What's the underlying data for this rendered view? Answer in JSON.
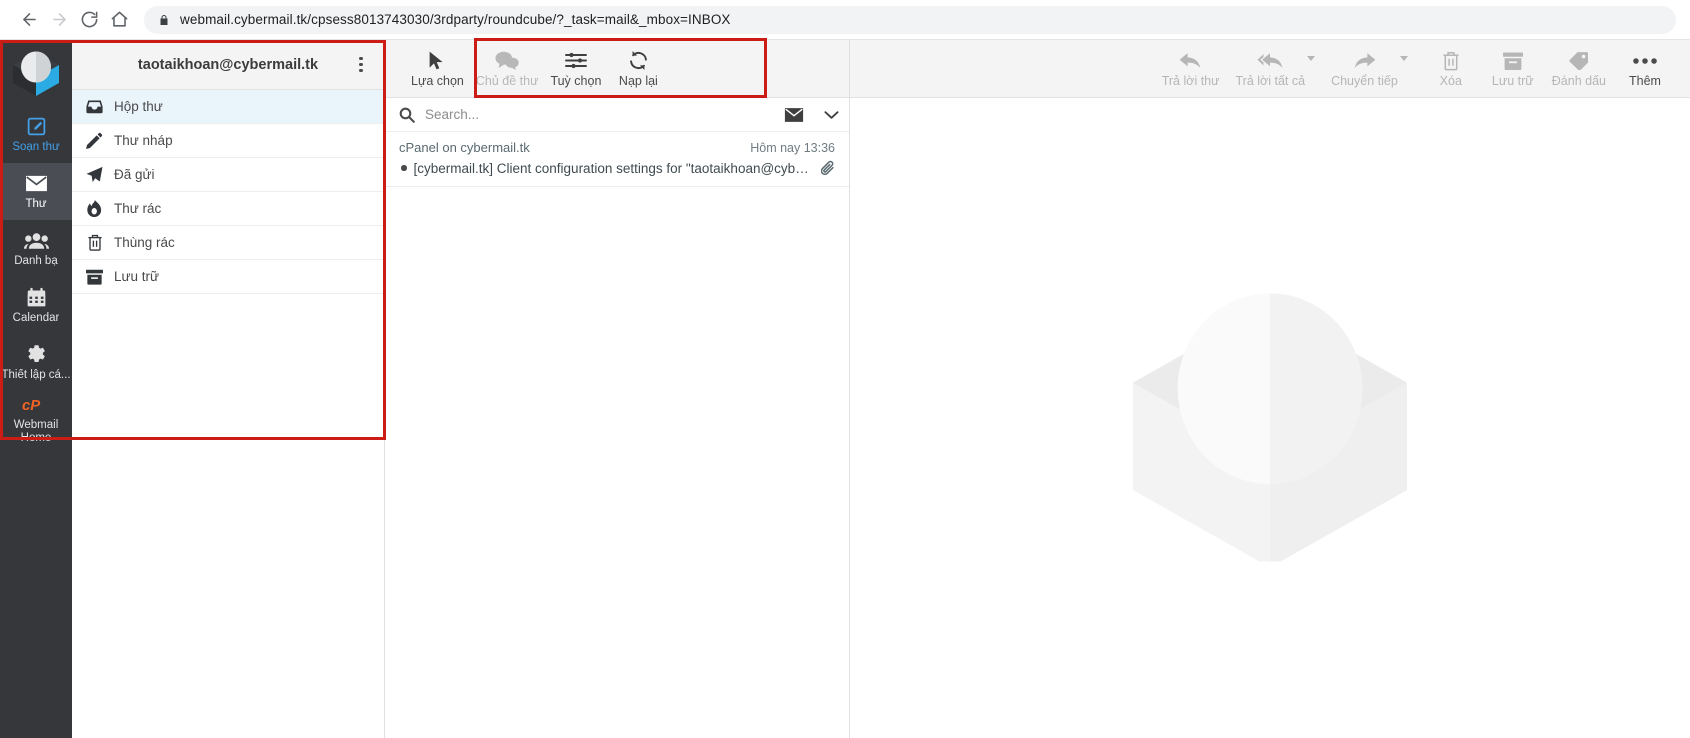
{
  "browser": {
    "back_icon": "arrow-left-icon",
    "forward_icon": "arrow-right-icon",
    "reload_icon": "reload-icon",
    "home_icon": "home-icon",
    "lock_icon": "lock-icon",
    "url": "webmail.cybermail.tk/cpsess8013743030/3rdparty/roundcube/?_task=mail&_mbox=INBOX"
  },
  "taskmenu": {
    "logo_icon": "roundcube-elastic-logo",
    "items": [
      {
        "label": "Soạn thư",
        "icon": "compose-pencil-icon",
        "state": "compose"
      },
      {
        "label": "Thư",
        "icon": "envelope-icon",
        "state": "selected"
      },
      {
        "label": "Danh bạ",
        "icon": "contacts-people-icon",
        "state": "normal"
      },
      {
        "label": "Calendar",
        "icon": "calendar-icon",
        "state": "normal"
      },
      {
        "label": "Thiết lập cá...",
        "icon": "gear-icon",
        "state": "normal"
      },
      {
        "label": "Webmail Home",
        "icon": "cpanel-logo-icon",
        "state": "normal"
      }
    ]
  },
  "folders": {
    "account": "taotaikhoan@cybermail.tk",
    "options_icon": "kebab-menu-icon",
    "items": [
      {
        "label": "Hộp thư",
        "icon": "inbox-icon",
        "selected": true
      },
      {
        "label": "Thư nháp",
        "icon": "pencil-icon",
        "selected": false
      },
      {
        "label": "Đã gửi",
        "icon": "paper-plane-icon",
        "selected": false
      },
      {
        "label": "Thư rác",
        "icon": "fire-junk-icon",
        "selected": false
      },
      {
        "label": "Thùng rác",
        "icon": "trash-icon",
        "selected": false
      },
      {
        "label": "Lưu trữ",
        "icon": "archive-box-icon",
        "selected": false
      }
    ]
  },
  "list_toolbar": {
    "buttons": [
      {
        "label": "Lựa chọn",
        "icon": "cursor-arrow-icon",
        "disabled": false
      },
      {
        "label": "Chủ đề thư",
        "icon": "threads-chat-icon",
        "disabled": true
      },
      {
        "label": "Tuỳ chọn",
        "icon": "sliders-options-icon",
        "disabled": false
      },
      {
        "label": "Nạp lại",
        "icon": "refresh-icon",
        "disabled": false
      }
    ]
  },
  "search": {
    "icon": "search-icon",
    "placeholder": "Search...",
    "value": "",
    "scope_icon": "envelope-icon",
    "expand_icon": "chevron-down-icon"
  },
  "message_list": {
    "rows": [
      {
        "from": "cPanel on cybermail.tk",
        "date": "Hôm nay 13:36",
        "subject": "[cybermail.tk] Client configuration settings for \"taotaikhoan@cyberm…",
        "unread": true,
        "attachment_icon": "paperclip-icon"
      }
    ]
  },
  "viewer_toolbar": {
    "buttons": [
      {
        "label": "Trả lời thư",
        "icon": "reply-icon",
        "disabled": true,
        "caret": false
      },
      {
        "label": "Trả lời tất cả",
        "icon": "reply-all-icon",
        "disabled": true,
        "caret": true
      },
      {
        "label": "Chuyển tiếp",
        "icon": "forward-icon",
        "disabled": true,
        "caret": true
      },
      {
        "label": "Xóa",
        "icon": "trash-icon",
        "disabled": true,
        "caret": false
      },
      {
        "label": "Lưu trữ",
        "icon": "archive-box-icon",
        "disabled": true,
        "caret": false
      },
      {
        "label": "Đánh dấu",
        "icon": "tag-icon",
        "disabled": true,
        "caret": false
      },
      {
        "label": "Thêm",
        "icon": "ellipsis-icon",
        "disabled": false,
        "caret": false
      }
    ]
  },
  "viewer": {
    "watermark_icon": "roundcube-elastic-watermark"
  },
  "colors": {
    "annotation": "#cc1c16",
    "taskmenu_bg": "#35373b",
    "accent_blue": "#44a0e8",
    "selected_folder_bg": "#eaf4fb",
    "toolbar_bg": "#f4f4f4"
  }
}
